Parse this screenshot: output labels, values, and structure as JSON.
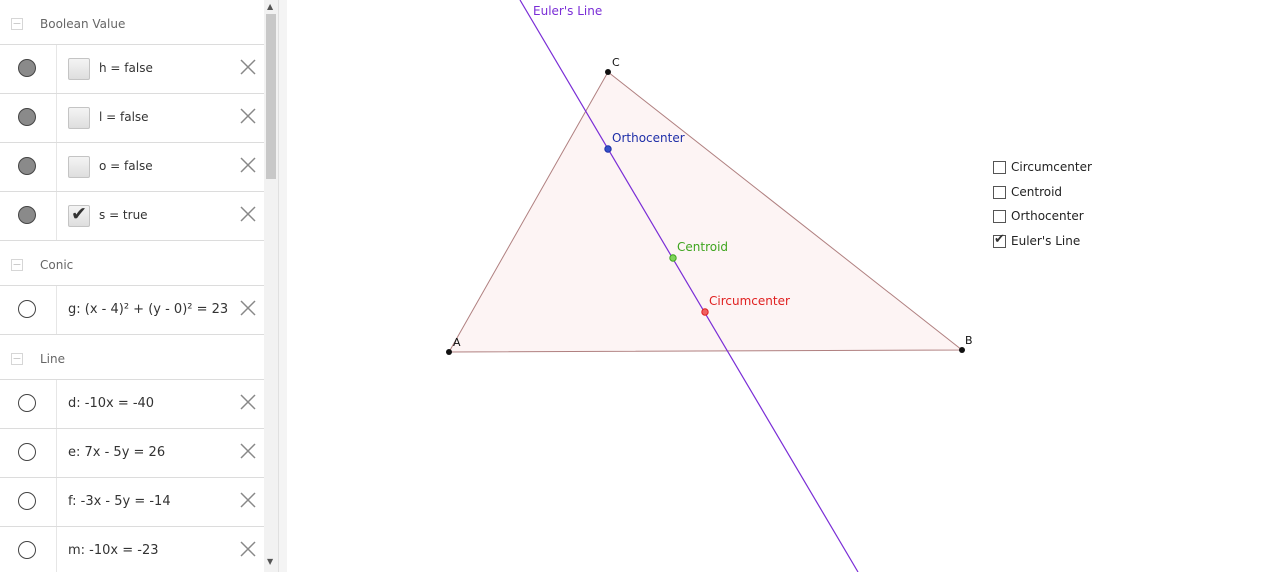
{
  "algebra": {
    "groups": [
      {
        "title": "Boolean Value",
        "items": [
          {
            "name": "h = false",
            "checked": false
          },
          {
            "name": "l = false",
            "checked": false
          },
          {
            "name": "o = false",
            "checked": false
          },
          {
            "name": "s = true",
            "checked": true
          }
        ]
      },
      {
        "title": "Conic",
        "items": [
          {
            "name": "g: (x - 4)² + (y - 0)² = 23"
          }
        ]
      },
      {
        "title": "Line",
        "items": [
          {
            "name": "d: -10x = -40"
          },
          {
            "name": "e: 7x - 5y = 26"
          },
          {
            "name": "f: -3x - 5y = -14"
          },
          {
            "name": "m: -10x = -23"
          }
        ]
      }
    ]
  },
  "graphics": {
    "points": {
      "A": "A",
      "B": "B",
      "C": "C"
    },
    "labels": {
      "euler_line": "Euler's Line",
      "orthocenter": "Orthocenter",
      "centroid": "Centroid",
      "circumcenter": "Circumcenter"
    },
    "colors": {
      "euler_line": "#7a2dd6",
      "orthocenter": "#1f2fa8",
      "centroid": "#3fa51f",
      "circumcenter": "#e02020",
      "triangle_fill": "#fdf4f4",
      "triangle_edge": "#b08080"
    }
  },
  "checkboxes": [
    {
      "label": "Circumcenter",
      "checked": false
    },
    {
      "label": "Centroid",
      "checked": false
    },
    {
      "label": "Orthocenter",
      "checked": false
    },
    {
      "label": "Euler's Line",
      "checked": true
    }
  ]
}
